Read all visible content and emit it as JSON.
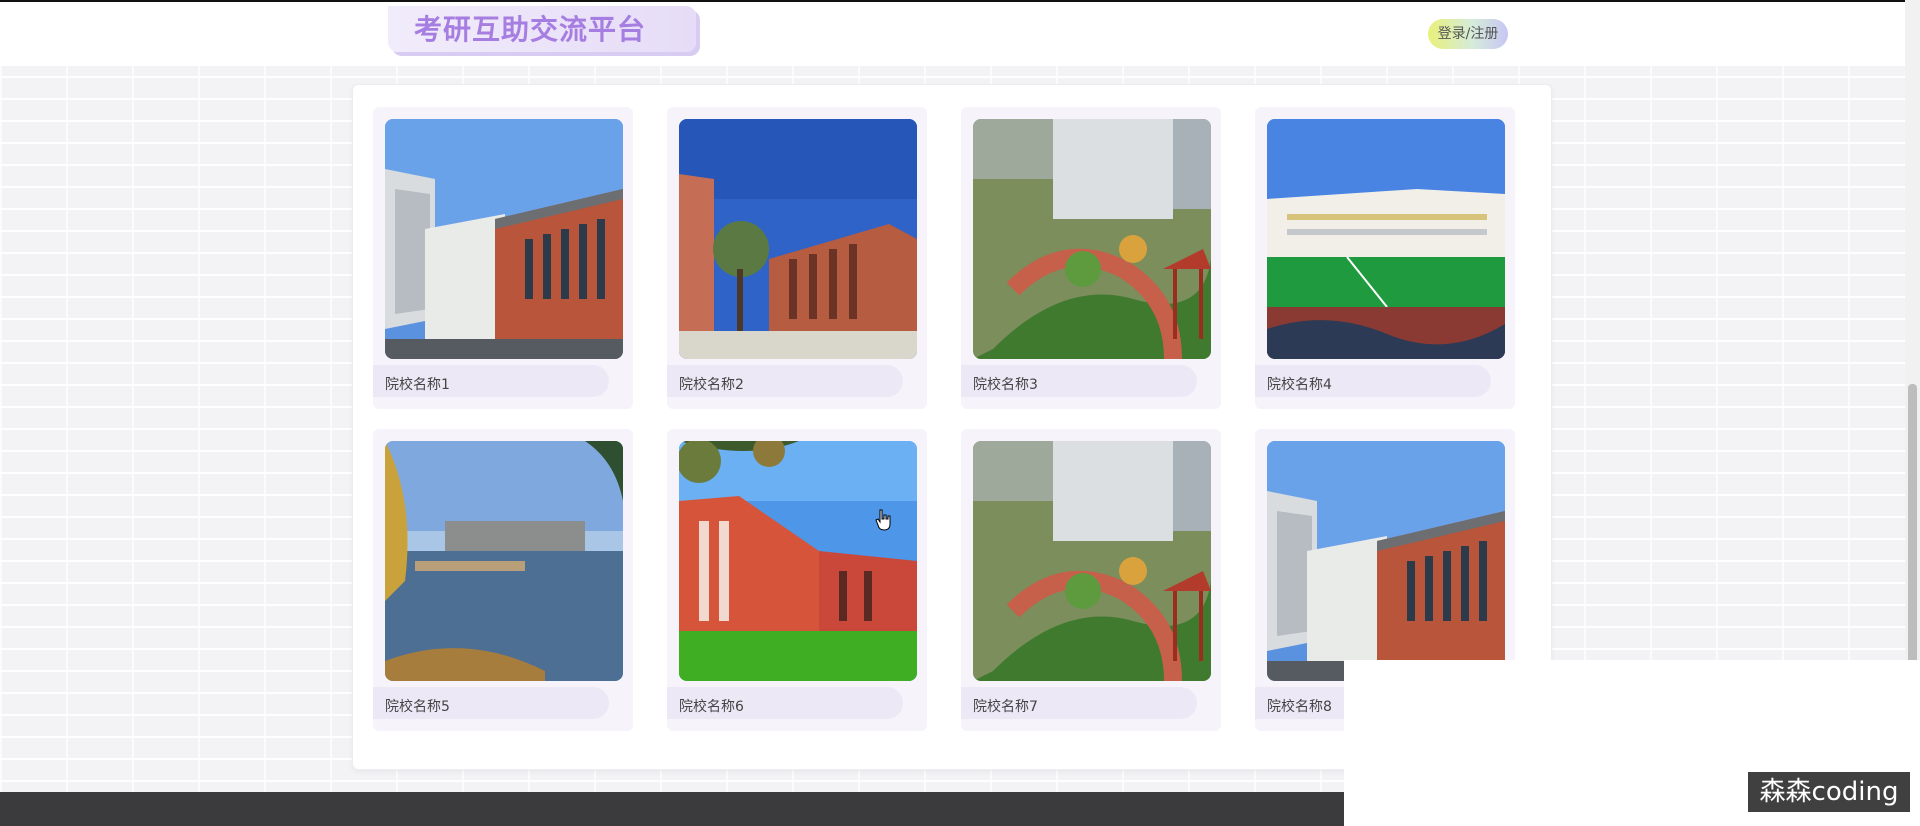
{
  "header": {
    "site_title": "考研互助交流平台",
    "login_label": "登录/注册"
  },
  "schools": [
    {
      "name": "院校名称1",
      "photo": "university-building-photo"
    },
    {
      "name": "院校名称2",
      "photo": "university-building-photo"
    },
    {
      "name": "院校名称3",
      "photo": "campus-garden-photo"
    },
    {
      "name": "院校名称4",
      "photo": "sports-field-photo"
    },
    {
      "name": "院校名称5",
      "photo": "campus-lake-photo"
    },
    {
      "name": "院校名称6",
      "photo": "campus-lawn-photo"
    },
    {
      "name": "院校名称7",
      "photo": "campus-garden-photo"
    },
    {
      "name": "院校名称8",
      "photo": "university-building-photo"
    }
  ],
  "watermark": "森森coding",
  "colors": {
    "title": "#a67de0",
    "card_bg": "#f6f4fa",
    "label_bg": "#ede8f6",
    "footer": "#3b3b3e"
  }
}
